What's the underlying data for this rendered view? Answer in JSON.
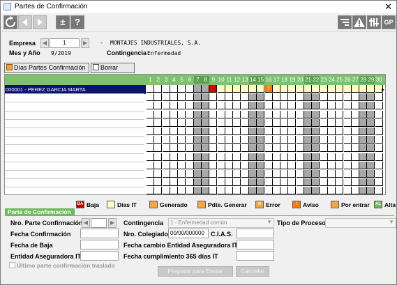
{
  "window": {
    "title": "Partes de Confirmación",
    "close_label": "✕"
  },
  "toolbar": {
    "left_buttons": [
      "refresh-icon",
      "back-icon",
      "forward-icon",
      "plus-minus-icon",
      "help-icon"
    ],
    "right_buttons": [
      "report-icon",
      "warning-icon",
      "settings-icon"
    ],
    "gp_label": "GP",
    "plusminus": "±",
    "help": "?"
  },
  "header": {
    "empresa_label": "Empresa",
    "empresa_number": "1",
    "empresa_sep": "-",
    "empresa_name": "MONTAJES INDUSTRIALES, S.A.",
    "mes_label": "Mes y Año",
    "mes_value": "9/2019",
    "contingencia_label": "Contingencia",
    "contingencia_value": "Enfermedad"
  },
  "actions": {
    "dias_partes": "Días Partes Confirmación",
    "borrar": "Borrar"
  },
  "grid": {
    "days": [
      "1",
      "2",
      "3",
      "4",
      "5",
      "6",
      "7",
      "8",
      "9",
      "10",
      "11",
      "12",
      "13",
      "14",
      "15",
      "16",
      "17",
      "18",
      "19",
      "20",
      "21",
      "22",
      "23",
      "24",
      "25",
      "26",
      "27",
      "28",
      "29",
      "30"
    ],
    "weekend_days": [
      7,
      8,
      14,
      15,
      21,
      22,
      28,
      29
    ],
    "employee": "000001 - PEREZ GARCIA MARTA",
    "baja_day": 9,
    "error_day": 16,
    "it_days_start": 9,
    "it_days_end": 30,
    "row_marker": "▸",
    "error_symbol": "!"
  },
  "legend": [
    {
      "label": "Baja",
      "code": "BA",
      "color": "#c00000"
    },
    {
      "label": "Días IT",
      "code": "",
      "color": "#fffcc6"
    },
    {
      "label": "Generado",
      "code": "",
      "color": "#f5a640"
    },
    {
      "label": "Pdte. Generar",
      "code": "",
      "color": "#f5a640"
    },
    {
      "label": "Error",
      "code": "✕",
      "color": "#f5a640"
    },
    {
      "label": "Aviso",
      "code": "!",
      "color": "#ff7a00"
    },
    {
      "label": "Por entrar",
      "code": "",
      "color": "#f5a640"
    },
    {
      "label": "Alta",
      "code": "AL",
      "color": "#6fba5e"
    }
  ],
  "form": {
    "section_title": "Parte de Confirmación",
    "nro_parte_label": "Nro. Parte Confirmación",
    "contingencia_label": "Contingencia",
    "contingencia_value": "1 - Enfermedad común",
    "tipo_proceso_label": "Tipo de Proceso",
    "fecha_conf_label": "Fecha Confirmación",
    "nro_colegiado_label": "Nro. Colegiado",
    "nro_colegiado_value": "00/00/000000",
    "cias_label": "C.I.A.S.",
    "fecha_baja_label": "Fecha de Baja",
    "fecha_cambio_label": "Fecha cambio Entidad Aseguradora IT",
    "entidad_label": "Entidad Aseguradora IT",
    "fecha_365_label": "Fecha cumplimiento 365 días IT",
    "ultimo_parte_label": "Último parte confirmación traslado"
  },
  "buttons": {
    "preparar": "Preparar para Enviar",
    "cancelar": "Cancelar"
  }
}
